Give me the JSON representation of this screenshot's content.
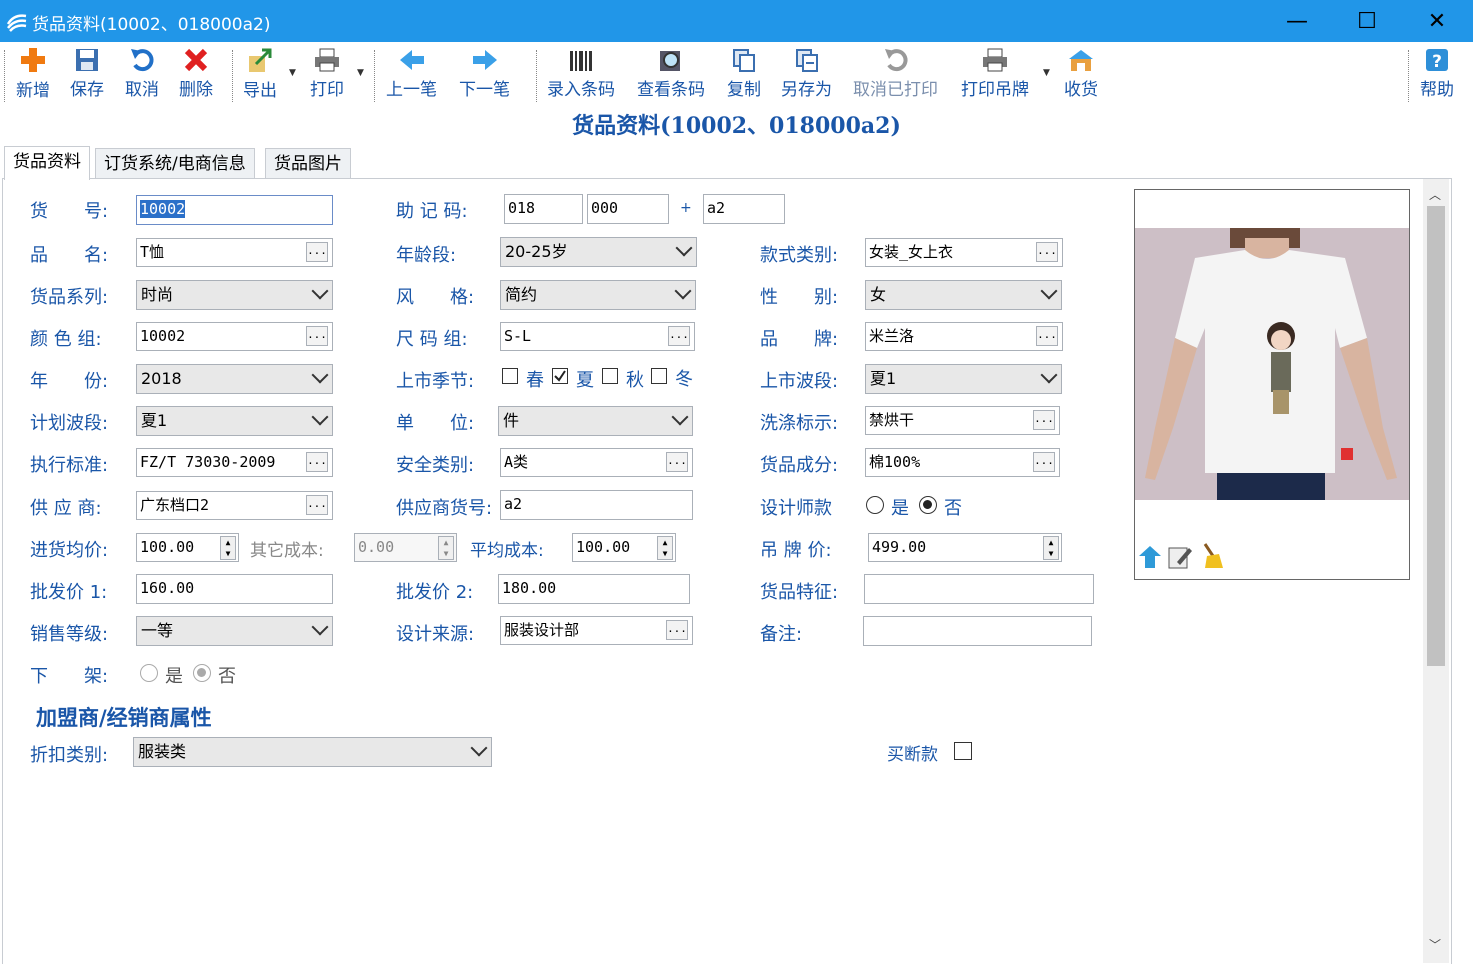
{
  "window": {
    "title": "货品资料(10002、018000a2)",
    "minimize": "—",
    "maximize": "☐",
    "close": "✕"
  },
  "toolbar": {
    "add": "新增",
    "save": "保存",
    "cancel": "取消",
    "delete": "删除",
    "export": "导出",
    "print": "打印",
    "prev": "上一笔",
    "next": "下一笔",
    "enter_barcode": "录入条码",
    "view_barcode": "查看条码",
    "copy": "复制",
    "save_as": "另存为",
    "cancel_printed": "取消已打印",
    "print_tag": "打印吊牌",
    "receive": "收货",
    "help": "帮助"
  },
  "heading": "货品资料(10002、018000a2)",
  "tabs": [
    "货品资料",
    "订货系统/电商信息",
    "货品图片"
  ],
  "form": {
    "item_no": {
      "label": "货　　号:",
      "value": "10002"
    },
    "mnemonic": {
      "label": "助 记 码:",
      "v1": "018",
      "v2": "000",
      "plus": "+",
      "v3": "a2"
    },
    "name": {
      "label": "品　　名:",
      "value": "T恤"
    },
    "age": {
      "label": "年龄段:",
      "value": "20-25岁"
    },
    "style_cat": {
      "label": "款式类别:",
      "value": "女装_女上衣"
    },
    "series": {
      "label": "货品系列:",
      "value": "时尚"
    },
    "style": {
      "label": "风　　格:",
      "value": "简约"
    },
    "gender": {
      "label": "性　　别:",
      "value": "女"
    },
    "color_group": {
      "label": "颜 色 组:",
      "value": "10002"
    },
    "size_group": {
      "label": "尺 码 组:",
      "value": "S-L"
    },
    "brand": {
      "label": "品　　牌:",
      "value": "米兰洛"
    },
    "year": {
      "label": "年　　份:",
      "value": "2018"
    },
    "season": {
      "label": "上市季节:",
      "spring": "春",
      "summer": "夏",
      "autumn": "秋",
      "winter": "冬",
      "summer_checked": true
    },
    "launch_wave": {
      "label": "上市波段:",
      "value": "夏1"
    },
    "plan_wave": {
      "label": "计划波段:",
      "value": "夏1"
    },
    "unit": {
      "label": "单　　位:",
      "value": "件"
    },
    "wash": {
      "label": "洗涤标示:",
      "value": "禁烘干"
    },
    "standard": {
      "label": "执行标准:",
      "value": "FZ/T 73030-2009"
    },
    "safety": {
      "label": "安全类别:",
      "value": "A类"
    },
    "composition": {
      "label": "货品成分:",
      "value": "棉100%"
    },
    "supplier": {
      "label": "供 应 商:",
      "value": "广东档口2"
    },
    "supplier_no": {
      "label": "供应商货号:",
      "value": "a2"
    },
    "designer": {
      "label": "设计师款",
      "yes": "是",
      "no": "否",
      "selected": "no"
    },
    "avg_purchase": {
      "label": "进货均价:",
      "value": "100.00"
    },
    "other_cost": {
      "label": "其它成本:",
      "value": "0.00"
    },
    "avg_cost": {
      "label": "平均成本:",
      "value": "100.00"
    },
    "tag_price": {
      "label": "吊 牌 价:",
      "value": "499.00"
    },
    "wholesale1": {
      "label": "批发价 1:",
      "value": "160.00"
    },
    "wholesale2": {
      "label": "批发价 2:",
      "value": "180.00"
    },
    "feature": {
      "label": "货品特征:",
      "value": ""
    },
    "sales_grade": {
      "label": "销售等级:",
      "value": "一等"
    },
    "design_source": {
      "label": "设计来源:",
      "value": "服装设计部"
    },
    "remark": {
      "label": "备注:",
      "value": ""
    },
    "off_shelf": {
      "label": "下　　架:",
      "yes": "是",
      "no": "否",
      "selected": "no"
    }
  },
  "section": {
    "title": "加盟商/经销商属性",
    "discount": {
      "label": "折扣类别:",
      "value": "服装类"
    },
    "buyout": {
      "label": "买断款"
    }
  },
  "ellipsis": "...",
  "colors": {
    "titlebar": "#2196e8",
    "label": "#1a56a8"
  }
}
